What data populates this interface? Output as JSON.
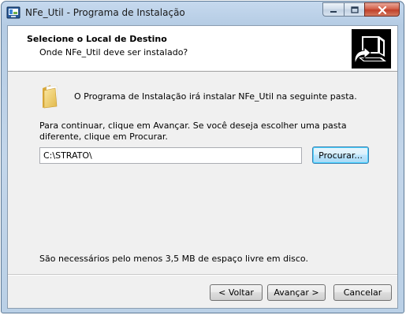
{
  "window": {
    "title": "NFe_Util - Programa de Instalação",
    "minimize_icon": "minimize-icon",
    "maximize_icon": "maximize-icon",
    "close_icon": "close-icon"
  },
  "header": {
    "title": "Selecione o Local de Destino",
    "subtitle": "Onde NFe_Util deve ser instalado?",
    "graphic_icon": "installer-computer-icon"
  },
  "body": {
    "folder_icon": "folder-icon",
    "intro": "O Programa de Instalação irá instalar NFe_Util na seguinte pasta.",
    "instruction": "Para continuar, clique em Avançar. Se você deseja escolher uma pasta diferente, clique em Procurar.",
    "path_value": "C:\\STRATO\\",
    "browse_label": "Procurar...",
    "space_required": "São necessários pelo menos 3,5 MB de espaço livre em disco."
  },
  "footer": {
    "back_label": "< Voltar",
    "next_label": "Avançar >",
    "cancel_label": "Cancelar"
  },
  "colors": {
    "header_bg": "#ffffff",
    "client_bg": "#f0f0f0",
    "close_button": "#c0402a",
    "focus_border": "#3c7fb1"
  }
}
